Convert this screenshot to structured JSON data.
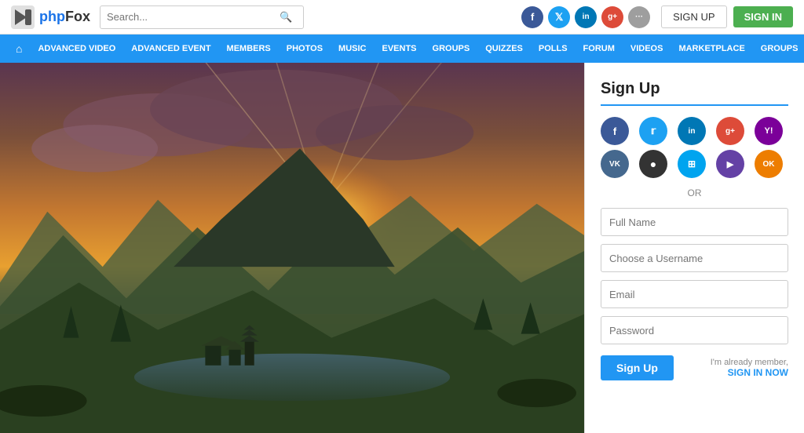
{
  "header": {
    "logo_text": "phpFox",
    "search_placeholder": "Search...",
    "btn_signup": "SIGN UP",
    "btn_signin": "SIGN IN"
  },
  "nav": {
    "items": [
      {
        "label": "Advanced Video",
        "key": "advanced-video"
      },
      {
        "label": "Advanced Event",
        "key": "advanced-event"
      },
      {
        "label": "Members",
        "key": "members"
      },
      {
        "label": "Photos",
        "key": "photos"
      },
      {
        "label": "Music",
        "key": "music"
      },
      {
        "label": "Events",
        "key": "events"
      },
      {
        "label": "Groups",
        "key": "groups"
      },
      {
        "label": "Quizzes",
        "key": "quizzes"
      },
      {
        "label": "Polls",
        "key": "polls"
      },
      {
        "label": "Forum",
        "key": "forum"
      },
      {
        "label": "Videos",
        "key": "videos"
      },
      {
        "label": "Marketplace",
        "key": "marketplace"
      },
      {
        "label": "Groups",
        "key": "groups2"
      }
    ]
  },
  "signup": {
    "title": "Sign Up",
    "or_text": "OR",
    "full_name_placeholder": "Full Name",
    "username_placeholder": "Choose a Username",
    "email_placeholder": "Email",
    "password_placeholder": "Password",
    "signup_btn": "Sign Up",
    "already_member_text": "I'm already member,",
    "signin_link": "SIGN IN NOW"
  },
  "social_top": [
    {
      "name": "facebook",
      "symbol": "f",
      "class": "sc-fb"
    },
    {
      "name": "twitter",
      "symbol": "t",
      "class": "sc-tw"
    },
    {
      "name": "linkedin",
      "symbol": "in",
      "class": "sc-li"
    },
    {
      "name": "google-plus",
      "symbol": "g+",
      "class": "sc-gp"
    },
    {
      "name": "more",
      "symbol": "···",
      "class": "sc-more"
    }
  ],
  "social_signup": [
    {
      "name": "facebook",
      "symbol": "f",
      "class": "soc-fb"
    },
    {
      "name": "twitter",
      "symbol": "t",
      "class": "soc-tw"
    },
    {
      "name": "linkedin",
      "symbol": "in",
      "class": "soc-li"
    },
    {
      "name": "google-plus",
      "symbol": "g+",
      "class": "soc-gp"
    },
    {
      "name": "yahoo",
      "symbol": "Y!",
      "class": "soc-yh"
    },
    {
      "name": "vk",
      "symbol": "VK",
      "class": "soc-vk"
    },
    {
      "name": "github",
      "symbol": "⊙",
      "class": "soc-gh"
    },
    {
      "name": "microsoft",
      "symbol": "⊞",
      "class": "soc-ms"
    },
    {
      "name": "twitch",
      "symbol": "▶",
      "class": "soc-tv"
    },
    {
      "name": "odnoklassniki",
      "symbol": "OK",
      "class": "soc-ok"
    }
  ]
}
